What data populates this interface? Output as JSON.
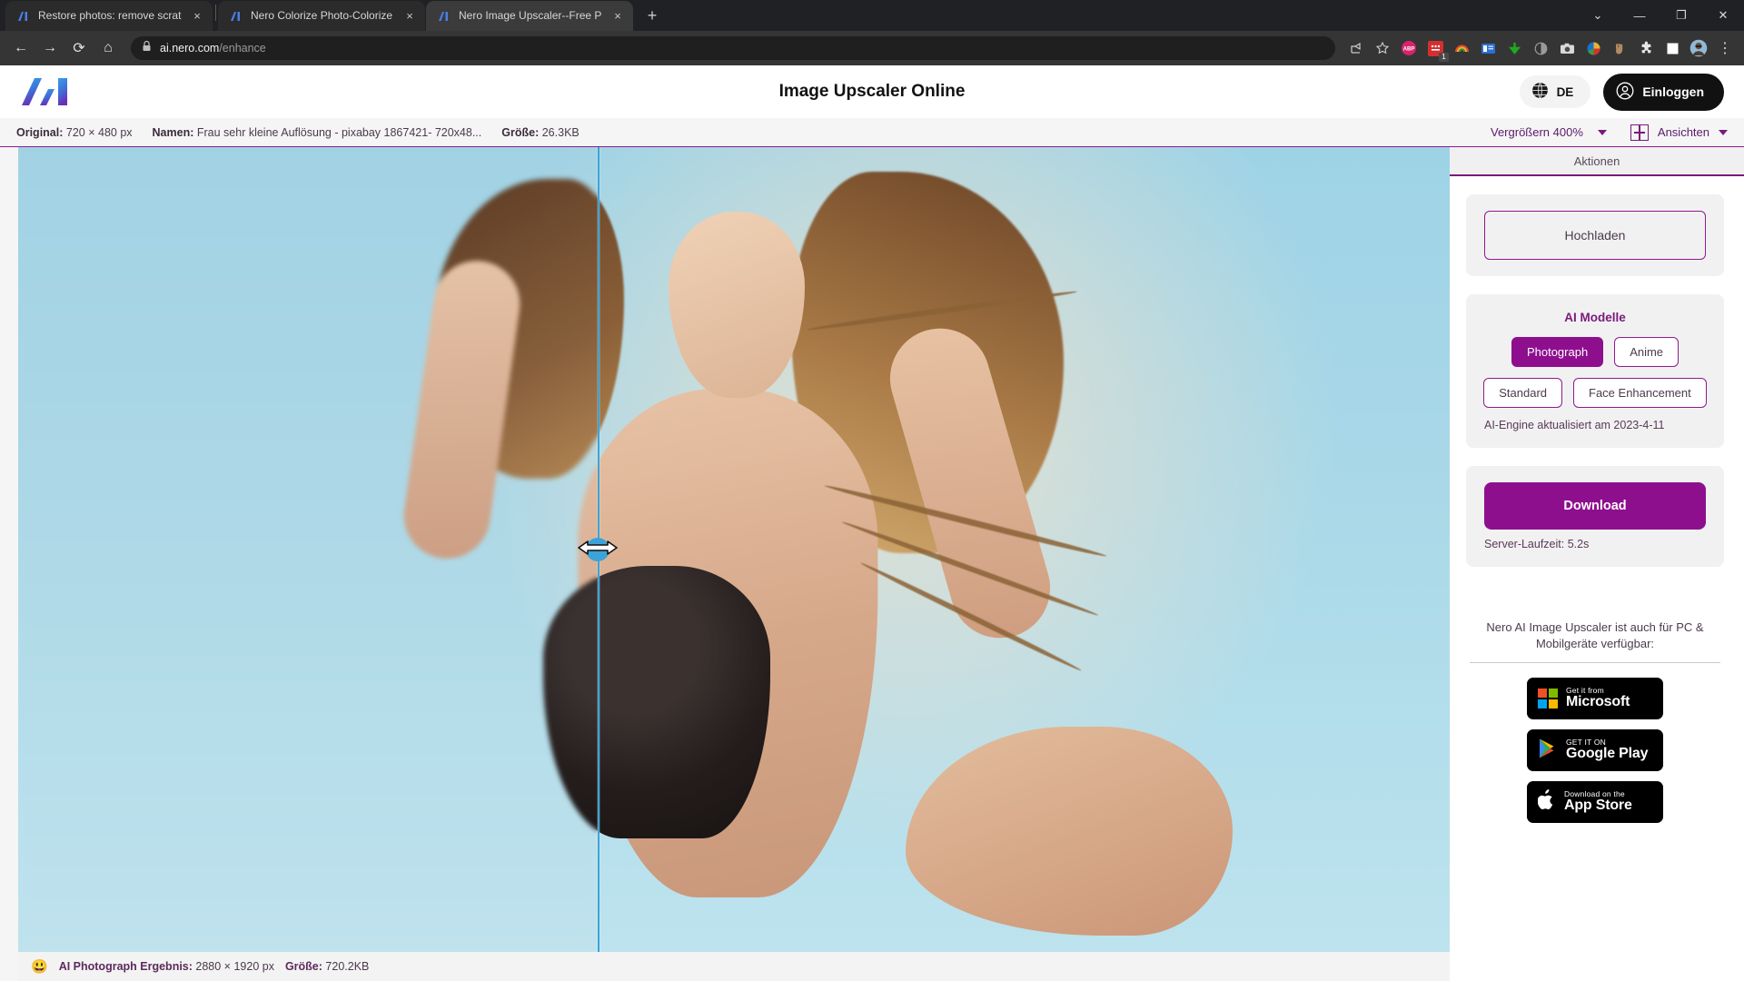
{
  "browser": {
    "tabs": [
      {
        "title": "Restore photos: remove scratche",
        "favicon": "nero-ai-icon",
        "active": false,
        "close": "×"
      },
      {
        "title": "Nero Colorize Photo-Colorize Yo",
        "favicon": "nero-ai-icon",
        "active": false,
        "close": "×"
      },
      {
        "title": "Nero Image Upscaler--Free Photo",
        "favicon": "nero-ai-icon",
        "active": true,
        "close": "×"
      }
    ],
    "new_tab_label": "+",
    "window_controls": {
      "minimize_all": "⌄",
      "minimize": "—",
      "maximize": "❐",
      "close": "✕"
    },
    "nav": {
      "back": "←",
      "forward": "→",
      "reload": "⟳",
      "home": "⌂"
    },
    "omnibox": {
      "lock_icon": "padlock-icon",
      "domain": "ai.nero.com",
      "path": "/enhance"
    },
    "toolbar_icons": [
      {
        "name": "share-icon",
        "label": ""
      },
      {
        "name": "bookmark-star-icon",
        "label": ""
      },
      {
        "name": "adblock-plus-icon",
        "label": "ABP"
      },
      {
        "name": "red-extension-icon",
        "label": "",
        "badge": "1"
      },
      {
        "name": "rainbow-extension-icon",
        "label": ""
      },
      {
        "name": "blue-card-extension-icon",
        "label": ""
      },
      {
        "name": "green-download-arrow-icon",
        "label": ""
      },
      {
        "name": "dark-reader-icon",
        "label": ""
      },
      {
        "name": "screenshot-camera-icon",
        "label": ""
      },
      {
        "name": "color-wheel-icon",
        "label": ""
      },
      {
        "name": "hand-extension-icon",
        "label": ""
      },
      {
        "name": "puzzle-extensions-icon",
        "label": ""
      },
      {
        "name": "white-square-icon",
        "label": ""
      },
      {
        "name": "profile-avatar-icon",
        "label": ""
      },
      {
        "name": "chrome-menu-icon",
        "label": "⋮"
      }
    ]
  },
  "header": {
    "logo_alt": "AI",
    "title": "Image Upscaler Online",
    "language": {
      "icon": "globe-icon",
      "label": "DE"
    },
    "login": {
      "icon": "user-circle-icon",
      "label": "Einloggen"
    }
  },
  "infobar": {
    "original_label": "Original:",
    "original_value": "720 × 480 px",
    "name_label": "Namen:",
    "name_value": "Frau sehr kleine Auflösung - pixabay 1867421- 720x48...",
    "size_label": "Größe:",
    "size_value": "26.3KB",
    "zoom_label": "Vergrößern 400%",
    "views_label": "Ansichten"
  },
  "statusbar": {
    "emoji": "😃",
    "result_label": "AI Photograph Ergebnis:",
    "result_value": "2880 × 1920 px",
    "size_label": "Größe:",
    "size_value": "720.2KB"
  },
  "sidebar": {
    "header": "Aktionen",
    "upload_label": "Hochladen",
    "models": {
      "title": "AI Modelle",
      "chips": [
        {
          "label": "Photograph",
          "active": true
        },
        {
          "label": "Anime",
          "active": false
        },
        {
          "label": "Standard",
          "active": false
        },
        {
          "label": "Face Enhancement",
          "active": false
        }
      ],
      "engine_note": "AI-Engine aktualisiert am 2023-4-11"
    },
    "download": {
      "label": "Download",
      "runtime": "Server-Laufzeit: 5.2s"
    },
    "promo": {
      "text": "Nero AI Image Upscaler ist auch für PC & Mobilgeräte verfügbar:",
      "badges": [
        {
          "name": "microsoft-store-badge",
          "line1": "Get it from",
          "line2": "Microsoft"
        },
        {
          "name": "google-play-badge",
          "line1": "GET IT ON",
          "line2": "Google Play"
        },
        {
          "name": "app-store-badge",
          "line1": "Download on the",
          "line2": "App Store"
        }
      ]
    }
  },
  "colors": {
    "accent_purple": "#8e0f8e",
    "accent_purple_border": "#8e1a8e",
    "slider_blue": "#3ba3d8"
  }
}
